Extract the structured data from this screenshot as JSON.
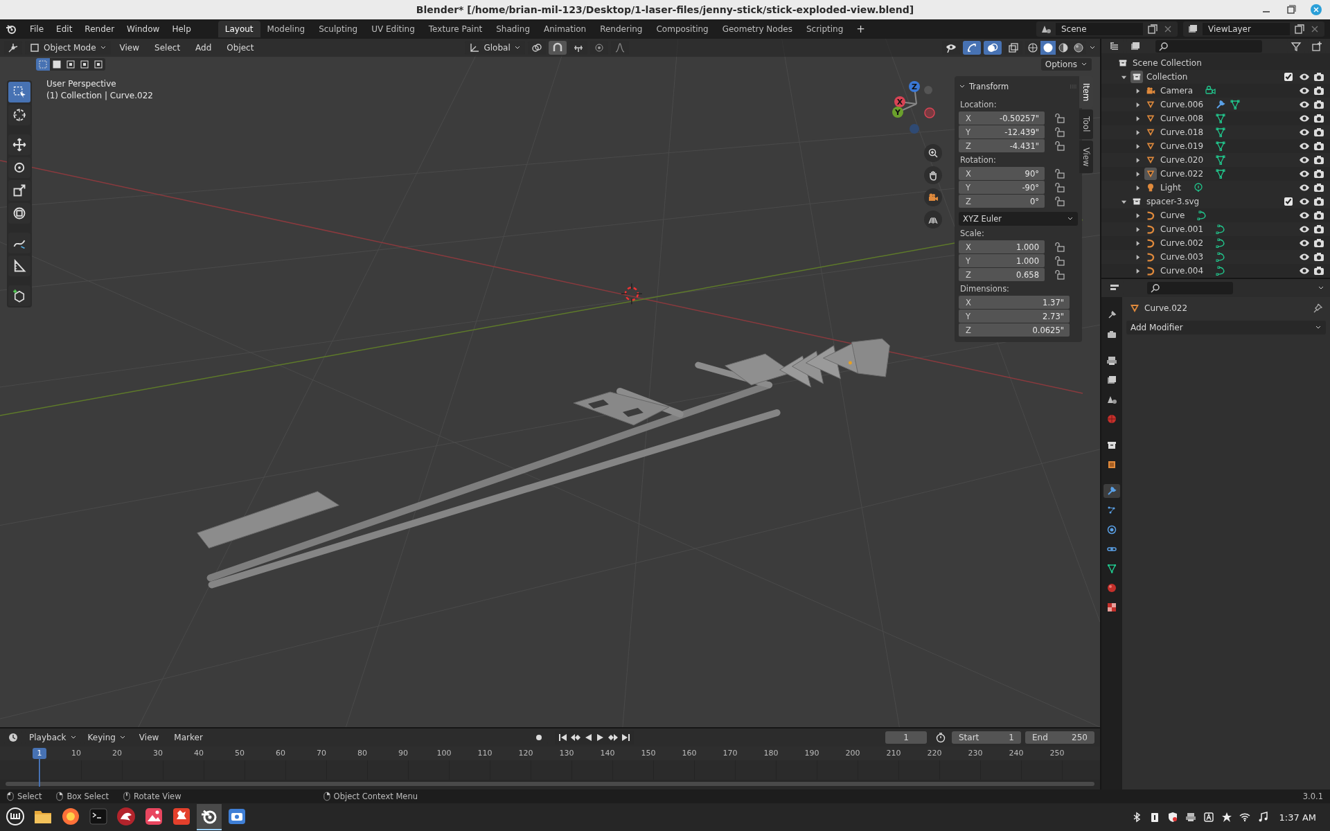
{
  "window": {
    "title": "Blender* [/home/brian-mil-123/Desktop/1-laser-files/jenny-stick/stick-exploded-view.blend]"
  },
  "menu": [
    "File",
    "Edit",
    "Render",
    "Window",
    "Help"
  ],
  "workspaces": [
    {
      "label": "Layout",
      "selected": true
    },
    {
      "label": "Modeling",
      "selected": false
    },
    {
      "label": "Sculpting",
      "selected": false
    },
    {
      "label": "UV Editing",
      "selected": false
    },
    {
      "label": "Texture Paint",
      "selected": false
    },
    {
      "label": "Shading",
      "selected": false
    },
    {
      "label": "Animation",
      "selected": false
    },
    {
      "label": "Rendering",
      "selected": false
    },
    {
      "label": "Compositing",
      "selected": false
    },
    {
      "label": "Geometry Nodes",
      "selected": false
    },
    {
      "label": "Scripting",
      "selected": false
    }
  ],
  "add_workspace": "+",
  "scene": "Scene",
  "view_layer": "ViewLayer",
  "viewport": {
    "mode": "Object Mode",
    "menus": [
      "View",
      "Select",
      "Add",
      "Object"
    ],
    "orientation": "Global",
    "toggles": [
      {
        "kind": "gizmo",
        "on": true
      },
      {
        "kind": "overlay",
        "on": true
      },
      {
        "kind": "xray",
        "on": false
      }
    ],
    "shading": [
      {
        "kind": "wireframe",
        "selected": false
      },
      {
        "kind": "solid",
        "selected": true
      },
      {
        "kind": "material",
        "selected": false
      },
      {
        "kind": "rendered",
        "selected": false
      }
    ],
    "select_modes": [
      {
        "selected": true
      },
      {
        "selected": false
      },
      {
        "selected": false
      },
      {
        "selected": false
      },
      {
        "selected": false
      }
    ],
    "options": "Options",
    "view_name": "User Perspective",
    "context": "(1) Collection | Curve.022",
    "tools": [
      {
        "kind": "select",
        "selected": true
      },
      {
        "kind": "cursor",
        "selected": false
      },
      {
        "kind": "move",
        "selected": false
      },
      {
        "kind": "rotate",
        "selected": false
      },
      {
        "kind": "scale",
        "selected": false
      },
      {
        "kind": "transform",
        "selected": false
      },
      {
        "kind": "annotate",
        "selected": false
      },
      {
        "kind": "measure",
        "selected": false
      },
      {
        "kind": "add_cube",
        "selected": false
      }
    ],
    "gizmo_axes": [
      "X",
      "Y",
      "Z"
    ]
  },
  "sidebar": {
    "tabs": [
      {
        "label": "Item",
        "selected": true
      },
      {
        "label": "Tool",
        "selected": false
      },
      {
        "label": "View",
        "selected": false
      }
    ],
    "panel": "Transform",
    "groups": [
      {
        "label": "Location:",
        "fields": [
          {
            "axis": "X",
            "value": "-0.50257\"",
            "locked": false
          },
          {
            "axis": "Y",
            "value": "-12.439\"",
            "locked": false
          },
          {
            "axis": "Z",
            "value": "-4.431\"",
            "locked": false
          }
        ]
      },
      {
        "label": "Rotation:",
        "fields": [
          {
            "axis": "X",
            "value": "90°",
            "locked": false
          },
          {
            "axis": "Y",
            "value": "-90°",
            "locked": false
          },
          {
            "axis": "Z",
            "value": "0°",
            "locked": false
          }
        ],
        "mode": "XYZ Euler"
      },
      {
        "label": "Scale:",
        "fields": [
          {
            "axis": "X",
            "value": "1.000",
            "locked": false
          },
          {
            "axis": "Y",
            "value": "1.000",
            "locked": false
          },
          {
            "axis": "Z",
            "value": "0.658",
            "locked": false
          }
        ]
      },
      {
        "label": "Dimensions:",
        "fields": [
          {
            "axis": "X",
            "value": "1.37\""
          },
          {
            "axis": "Y",
            "value": "2.73\""
          },
          {
            "axis": "Z",
            "value": "0.0625\""
          }
        ]
      }
    ]
  },
  "outliner": {
    "tree": [
      {
        "name": "Scene Collection",
        "kind": "scene_collection",
        "children": [
          {
            "name": "Collection",
            "kind": "collection",
            "expanded": true,
            "checked": true,
            "active": true,
            "children": [
              {
                "name": "Camera",
                "kind": "camera",
                "expanded": false,
                "active": false
              },
              {
                "name": "Curve.006",
                "kind": "mesh",
                "expanded": false,
                "active": false,
                "modifier": true
              },
              {
                "name": "Curve.008",
                "kind": "mesh",
                "expanded": false,
                "active": false
              },
              {
                "name": "Curve.018",
                "kind": "mesh",
                "expanded": false,
                "active": false
              },
              {
                "name": "Curve.019",
                "kind": "mesh",
                "expanded": false,
                "active": false
              },
              {
                "name": "Curve.020",
                "kind": "mesh",
                "expanded": false,
                "active": false
              },
              {
                "name": "Curve.022",
                "kind": "mesh",
                "expanded": false,
                "active": true
              },
              {
                "name": "Light",
                "kind": "light",
                "expanded": false,
                "active": false
              }
            ]
          },
          {
            "name": "spacer-3.svg",
            "kind": "collection",
            "expanded": true,
            "checked": true,
            "active": false,
            "children": [
              {
                "name": "Curve",
                "kind": "curve",
                "expanded": false,
                "active": false
              },
              {
                "name": "Curve.001",
                "kind": "curve",
                "expanded": false,
                "active": false
              },
              {
                "name": "Curve.002",
                "kind": "curve",
                "expanded": false,
                "active": false
              },
              {
                "name": "Curve.003",
                "kind": "curve",
                "expanded": false,
                "active": false
              },
              {
                "name": "Curve.004",
                "kind": "curve",
                "expanded": false,
                "active": false
              }
            ]
          }
        ]
      }
    ]
  },
  "properties": {
    "tabs": [
      {
        "kind": "tool",
        "selected": false
      },
      {
        "kind": "render",
        "selected": false
      },
      {
        "kind": "output",
        "selected": false
      },
      {
        "kind": "view_layer",
        "selected": false
      },
      {
        "kind": "scene",
        "selected": false
      },
      {
        "kind": "world",
        "selected": false
      },
      {
        "kind": "collection",
        "selected": false
      },
      {
        "kind": "object",
        "selected": false
      },
      {
        "kind": "modifiers",
        "selected": true
      },
      {
        "kind": "particles",
        "selected": false
      },
      {
        "kind": "physics",
        "selected": false
      },
      {
        "kind": "constraints",
        "selected": false
      },
      {
        "kind": "data",
        "selected": false
      },
      {
        "kind": "material",
        "selected": false
      },
      {
        "kind": "texture",
        "selected": false
      }
    ],
    "object": "Curve.022",
    "add_modifier": "Add Modifier"
  },
  "timeline": {
    "menus": [
      "Playback",
      "Keying",
      "View",
      "Marker"
    ],
    "current_frame": "1",
    "start_label": "Start",
    "start": "1",
    "end_label": "End",
    "end": "250",
    "playhead": "1",
    "ruler": [
      "10",
      "20",
      "30",
      "40",
      "50",
      "60",
      "70",
      "80",
      "90",
      "100",
      "110",
      "120",
      "130",
      "140",
      "150",
      "160",
      "170",
      "180",
      "190",
      "200",
      "210",
      "220",
      "230",
      "240",
      "250"
    ]
  },
  "status_bar": {
    "hints": [
      "Select",
      "Box Select",
      "Rotate View",
      "Object Context Menu"
    ],
    "version": "3.0.1"
  },
  "taskbar": {
    "apps": [
      {
        "kind": "menu",
        "selected": false
      },
      {
        "kind": "folder",
        "selected": false
      },
      {
        "kind": "browser",
        "selected": false
      },
      {
        "kind": "terminal",
        "selected": false
      },
      {
        "kind": "dragon",
        "selected": false
      },
      {
        "kind": "photos",
        "selected": false
      },
      {
        "kind": "paint",
        "selected": false
      },
      {
        "kind": "blender",
        "selected": true
      },
      {
        "kind": "camera",
        "selected": false
      }
    ],
    "clock": "1:37 AM"
  }
}
